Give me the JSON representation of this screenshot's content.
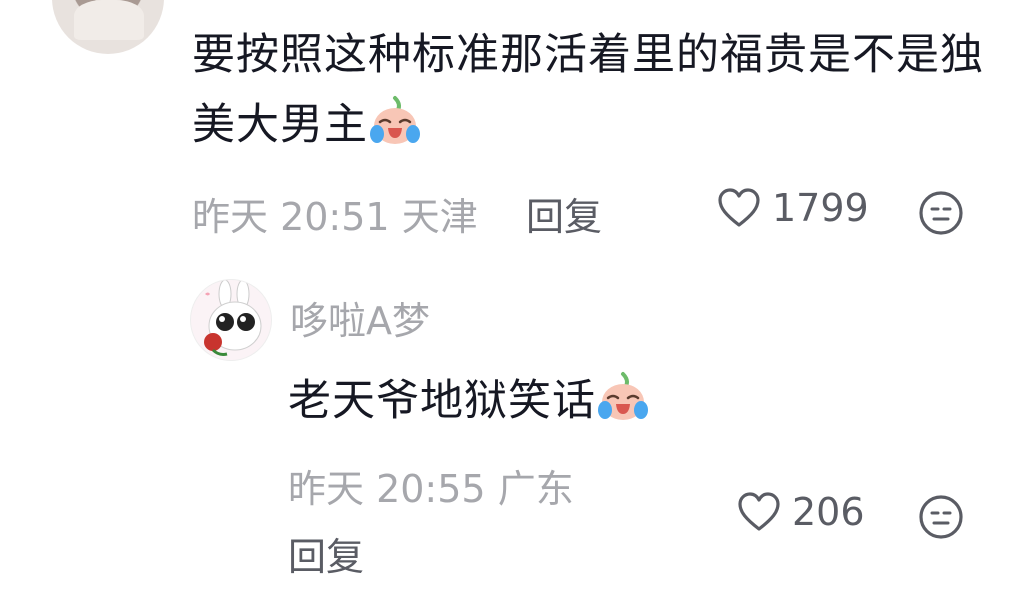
{
  "top_comment": {
    "text": "要按照这种标准那活着里的福贵是不是独美大男主",
    "emoji": "crying-laughing-peach-emoji",
    "time": "昨天 20:51",
    "location": "天津",
    "reply_label": "回复",
    "likes": "1799"
  },
  "reply": {
    "author": "哆啦A梦",
    "text": "老天爷地狱笑话",
    "emoji": "crying-laughing-peach-emoji",
    "time": "昨天 20:55",
    "location": "广东",
    "reply_label": "回复",
    "likes": "206"
  },
  "colors": {
    "text": "#161823",
    "meta": "#a6a7ac",
    "action": "#5a5c64"
  }
}
